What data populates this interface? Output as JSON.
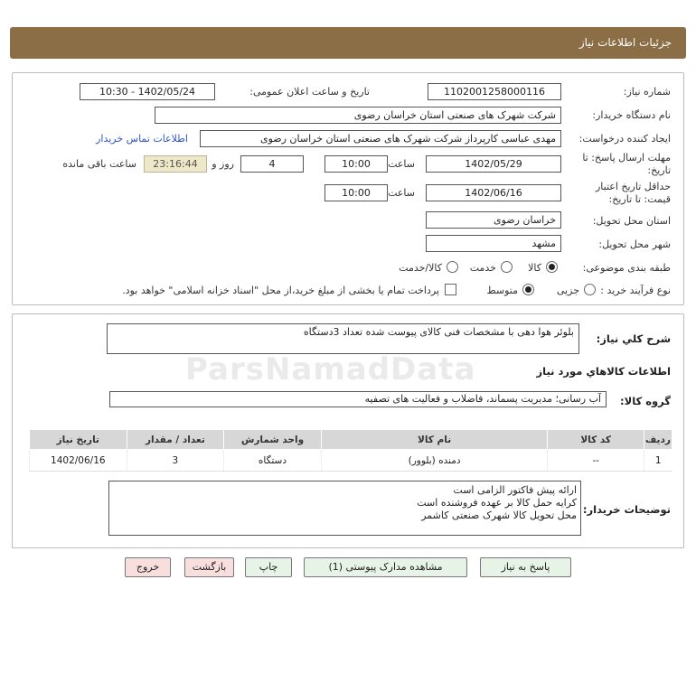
{
  "header": {
    "title": "جزئیات اطلاعات نیاز"
  },
  "form": {
    "need_number": {
      "label": "شماره نیاز:",
      "value": "1102001258000116"
    },
    "announce_datetime": {
      "label": "تاریخ و ساعت اعلان عمومی:",
      "value": "1402/05/24 - 10:30"
    },
    "buyer_org": {
      "label": "نام دستگاه خریدار:",
      "value": "شرکت شهرک های صنعتی استان خراسان رضوی"
    },
    "requester": {
      "label": "ایجاد کننده درخواست:",
      "value": "مهدی عباسی کارپرداز شرکت شهرک های صنعتی استان خراسان رضوی",
      "contact_link": "اطلاعات تماس خریدار"
    },
    "response_deadline": {
      "label_line1": "مهلت ارسال پاسخ: تا",
      "label_line2": "تاریخ:",
      "date": "1402/05/29",
      "time_label": "ساعت",
      "time": "10:00",
      "days": "4",
      "days_label": "روز و",
      "remaining": "23:16:44",
      "remaining_label": "ساعت باقی مانده"
    },
    "price_validity": {
      "label_line1": "حداقل تاریخ اعتبار",
      "label_line2": "قیمت: تا تاریخ:",
      "date": "1402/06/16",
      "time_label": "ساعت",
      "time": "10:00"
    },
    "delivery_province": {
      "label": "استان محل تحویل:",
      "value": "خراسان رضوی"
    },
    "delivery_city": {
      "label": "شهر محل تحویل:",
      "value": "مشهد"
    },
    "category": {
      "label": "طبقه بندی موضوعی:",
      "options": [
        "کالا",
        "خدمت",
        "کالا/خدمت"
      ],
      "selected": "کالا"
    },
    "purchase_type": {
      "label": "نوع فرآیند خرید :",
      "options": [
        "جزیی",
        "متوسط"
      ],
      "selected": "متوسط",
      "checkbox_text": "پرداخت تمام یا بخشی از مبلغ خرید،از محل \"اسناد خزانه اسلامی\" خواهد بود."
    }
  },
  "details": {
    "summary_label": "شرح کلي نياز:",
    "summary": "بلوئر هوا دهی با مشخصات فنی کالای پیوست شده   تعداد 3دستگاه",
    "goods_info_title": "اطلاعات کالاهاي مورد نياز",
    "goods_group_label": "گروه کالا:",
    "goods_group": "آب رسانی؛ مدیریت پسماند، فاضلاب و فعالیت های تصفیه",
    "table": {
      "headers": [
        "ردیف",
        "کد کالا",
        "نام کالا",
        "واحد شمارش",
        "تعداد / مقدار",
        "تاریخ نیاز"
      ],
      "rows": [
        [
          "1",
          "--",
          "دمنده (بلوور)",
          "دستگاه",
          "3",
          "1402/06/16"
        ]
      ]
    },
    "buyer_notes_label": "توضیحات خریدار:",
    "buyer_notes": [
      "ارائه پیش فاکتور الزامی است",
      "کرایه حمل کالا بر عهده فروشنده است",
      "محل تحویل کالا شهرک صنعتی کاشمر"
    ]
  },
  "buttons": {
    "reply": "پاسخ به نیاز",
    "view_docs": "مشاهده مدارک پیوستی (1)",
    "print": "چاپ",
    "back": "بازگشت",
    "exit": "خروج"
  },
  "watermark": "ParsNamadData"
}
